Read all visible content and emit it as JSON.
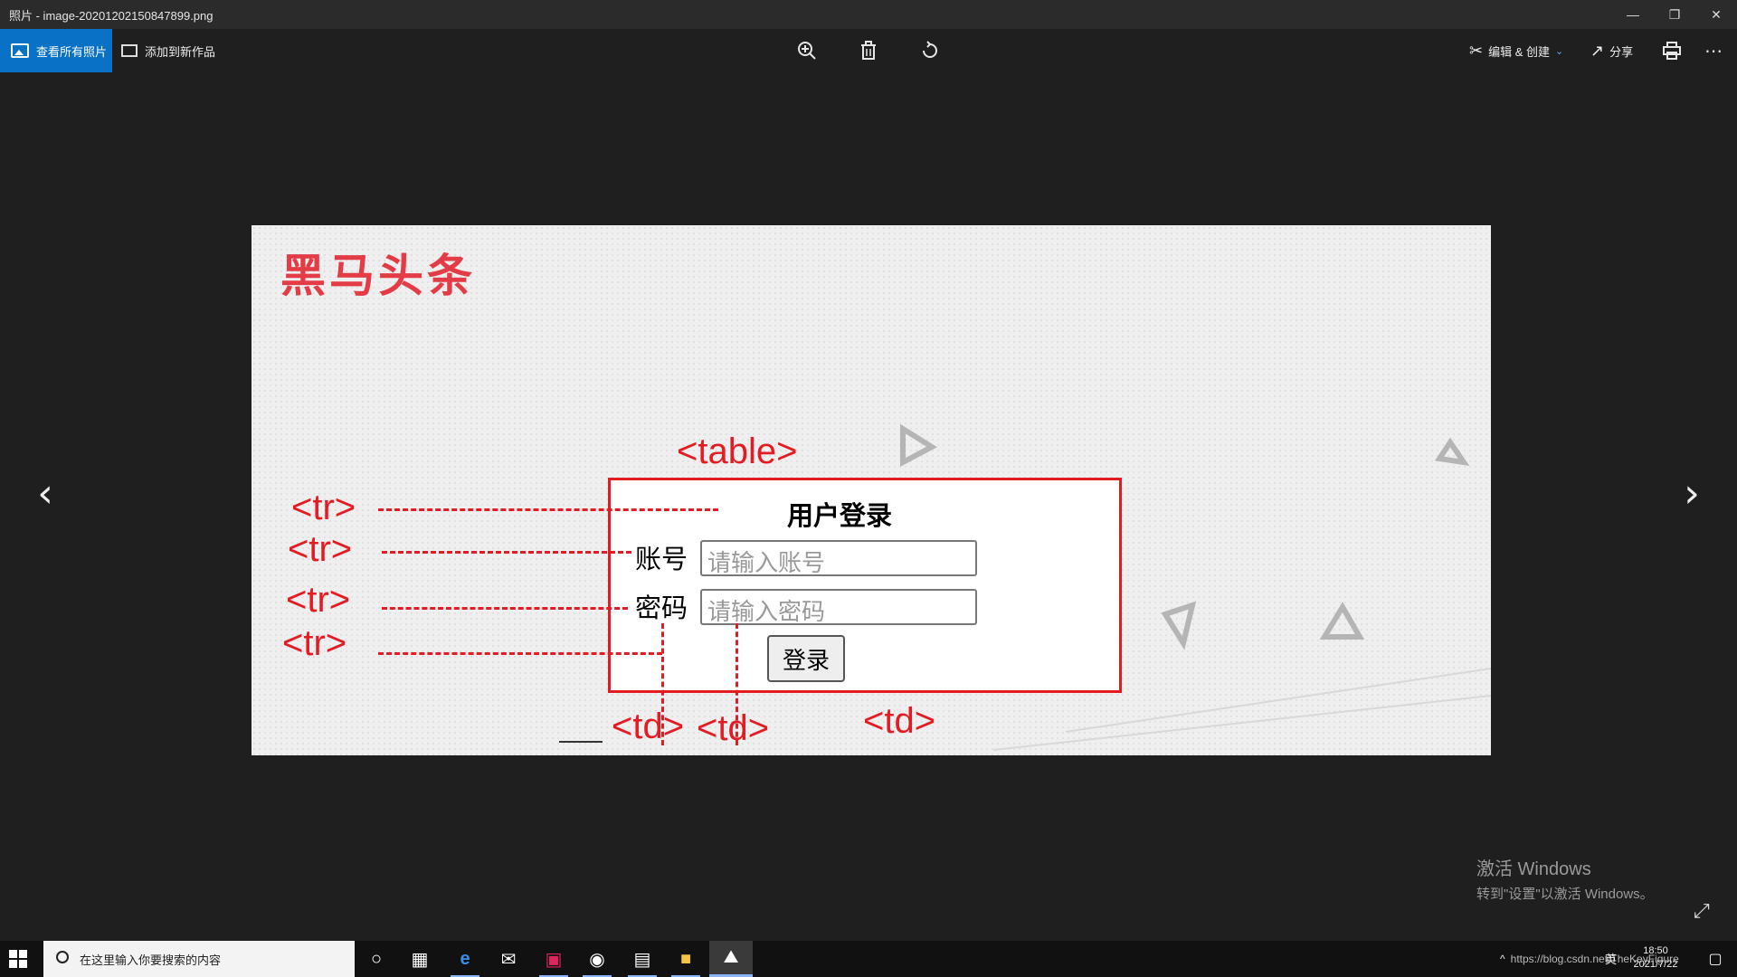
{
  "window": {
    "title": "照片 - image-20201202150847899.png"
  },
  "toolbar": {
    "view_all_label": "查看所有照片",
    "add_to_work_label": "添加到新作品",
    "edit_create_label": "编辑 & 创建",
    "share_label": "分享"
  },
  "photo": {
    "brand": "黑马头条",
    "table_tag": "<table>",
    "tr_tag": "<tr>",
    "td_tag": "<td>",
    "login": {
      "title": "用户登录",
      "account_label": "账号",
      "account_placeholder": "请输入账号",
      "password_label": "密码",
      "password_placeholder": "请输入密码",
      "submit_label": "登录"
    }
  },
  "watermark": {
    "line1": "激活 Windows",
    "line2": "转到\"设置\"以激活 Windows。"
  },
  "taskbar": {
    "search_placeholder": "在这里输入你要搜索的内容",
    "time": "18:50",
    "date": "2021/7/22",
    "url_overlay": "https://blog.csdn.net/TheKeyFigure",
    "ime": "英"
  },
  "colors": {
    "accent": "#0a72c6",
    "annotation_red": "#e31c23",
    "brand_red": "#e43c46"
  }
}
